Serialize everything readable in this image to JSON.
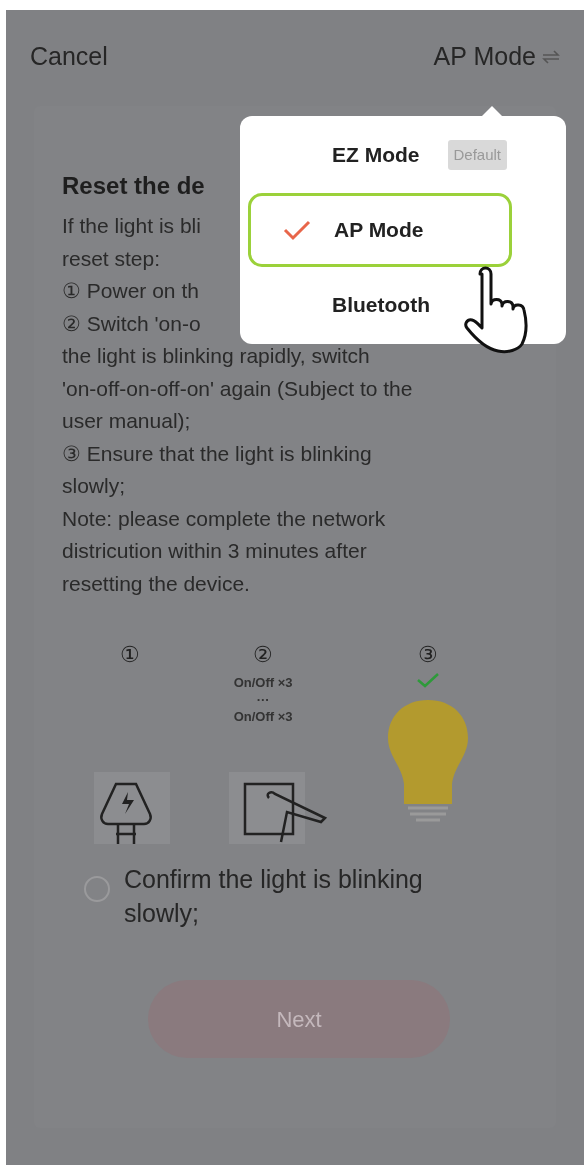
{
  "header": {
    "cancel": "Cancel",
    "mode": "AP Mode"
  },
  "mode_menu": [
    {
      "label": "EZ Mode",
      "badge": "Default",
      "selected": false
    },
    {
      "label": "AP Mode",
      "selected": true
    },
    {
      "label": "Bluetooth",
      "selected": false
    }
  ],
  "heading": "Reset the de",
  "instructions": [
    "If the light is bli",
    "reset step:",
    "① Power on th",
    "② Switch 'on-o",
    "the light is blinking rapidly, switch",
    "'on-off-on-off-on' again (Subject to the",
    "user manual);",
    "③ Ensure that the light is blinking",
    "slowly;",
    "Note: please complete the network",
    "districution within 3 minutes after",
    "resetting the device."
  ],
  "steps": [
    {
      "number": "①",
      "kind": "plug"
    },
    {
      "number": "②",
      "kind": "switch",
      "labels": [
        "On/Off ×3",
        "···",
        "On/Off ×3"
      ]
    },
    {
      "number": "③",
      "kind": "bulb"
    }
  ],
  "confirm": {
    "label": "Confirm the light is blinking slowly;",
    "checked": false
  },
  "next_button": {
    "label": "Next",
    "disabled": true
  }
}
